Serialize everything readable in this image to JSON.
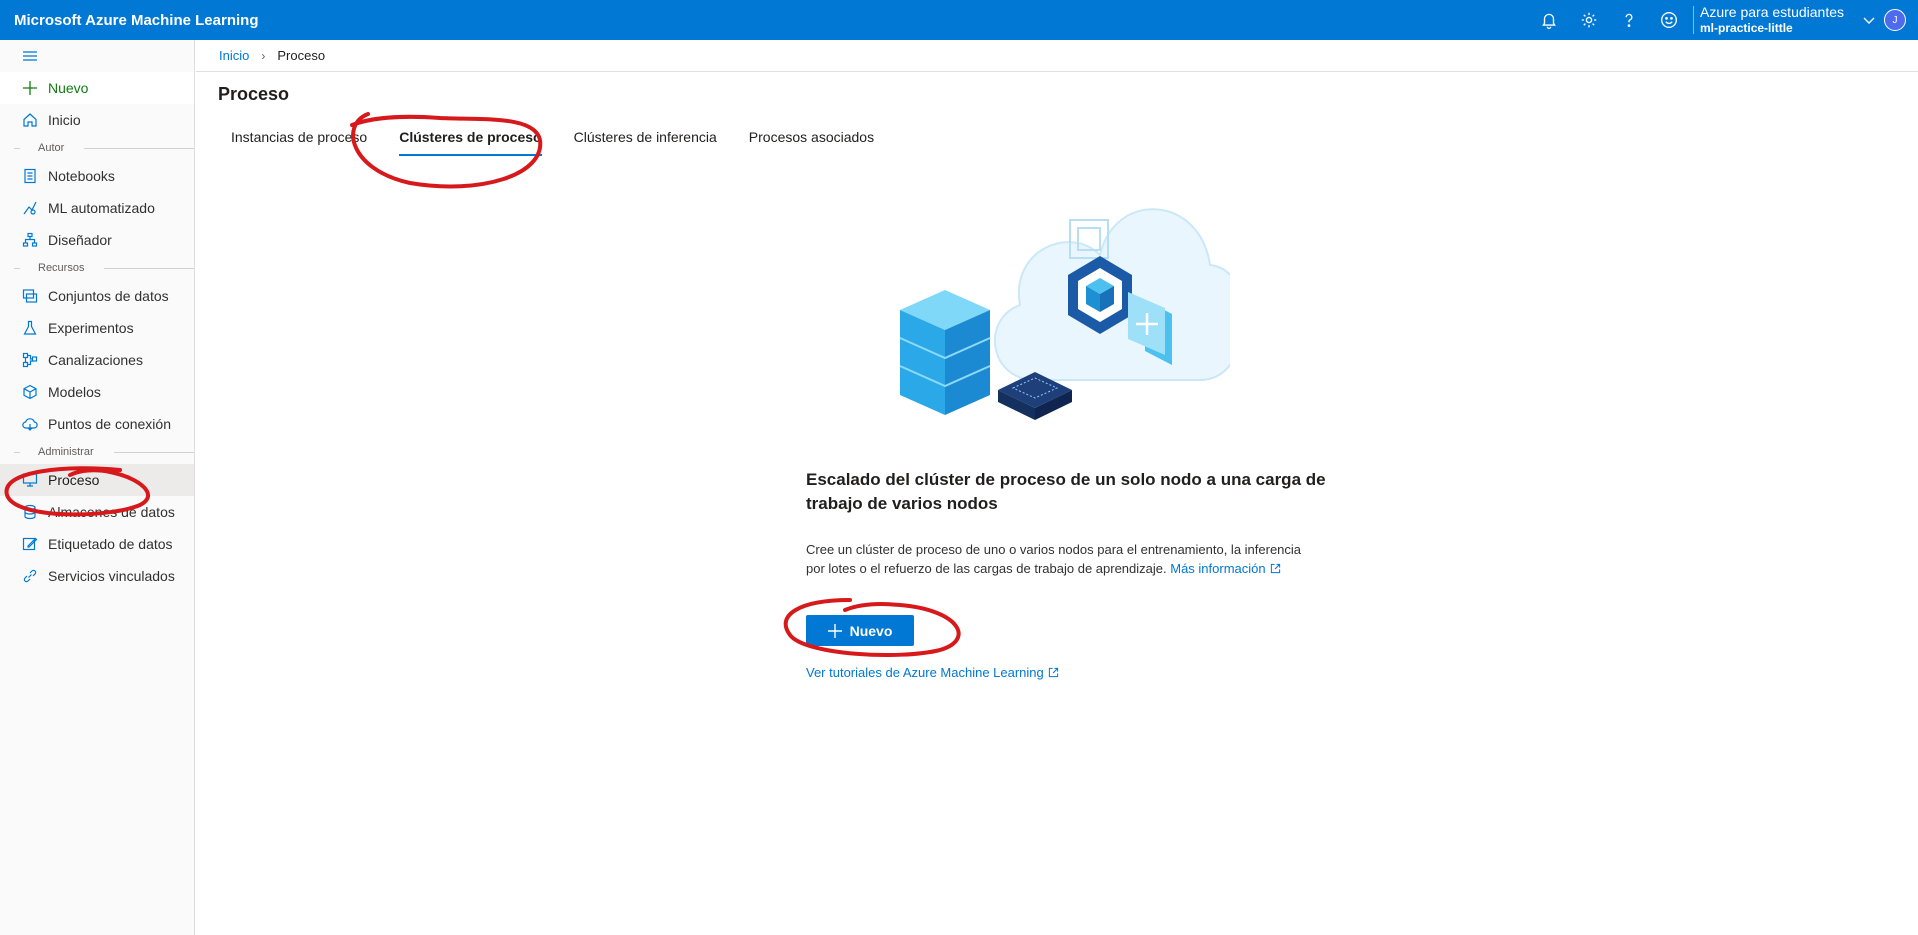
{
  "header": {
    "brand": "Microsoft Azure Machine Learning",
    "account_name": "Azure para estudiantes",
    "workspace": "ml-practice-little",
    "avatar_initial": "J",
    "color": "#0078d4"
  },
  "sidebar": {
    "new_label": "Nuevo",
    "home_label": "Inicio",
    "sections": {
      "author": "Autor",
      "resources": "Recursos",
      "manage": "Administrar"
    },
    "items": {
      "notebooks": "Notebooks",
      "automl": "ML automatizado",
      "designer": "Diseñador",
      "datasets": "Conjuntos de datos",
      "experiments": "Experimentos",
      "pipelines": "Canalizaciones",
      "models": "Modelos",
      "endpoints": "Puntos de conexión",
      "compute": "Proceso",
      "datastores": "Almacenes de datos",
      "labeling": "Etiquetado de datos",
      "linked": "Servicios vinculados"
    }
  },
  "breadcrumb": {
    "home": "Inicio",
    "current": "Proceso"
  },
  "main": {
    "title": "Proceso",
    "tabs": [
      "Instancias de proceso",
      "Clústeres de proceso",
      "Clústeres de inferencia",
      "Procesos asociados"
    ],
    "active_tab": "Clústeres de proceso",
    "empty_title": "Escalado del clúster de proceso de un solo nodo a una carga de trabajo de varios nodos",
    "empty_desc": "Cree un clúster de proceso de uno o varios nodos para el entrenamiento, la inferencia por lotes o el refuerzo de las cargas de trabajo de aprendizaje.",
    "more_info": "Más información",
    "new_button": "Nuevo",
    "tutorials_link": "Ver tutoriales de Azure Machine Learning"
  }
}
